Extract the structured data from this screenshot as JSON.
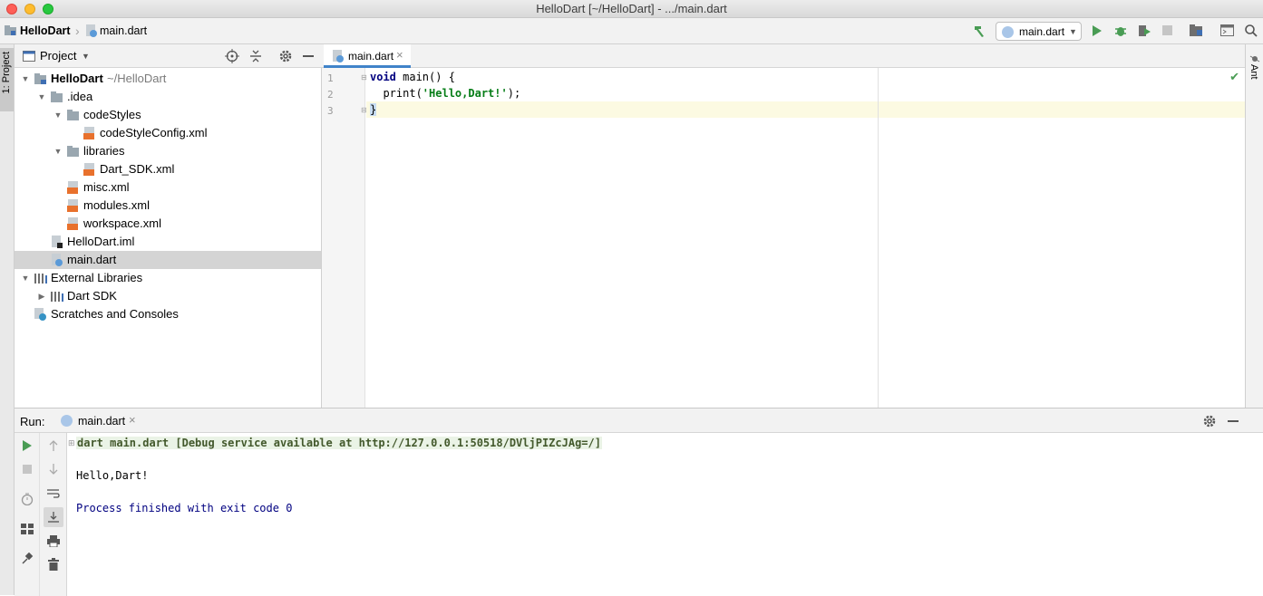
{
  "window": {
    "title": "HelloDart [~/HelloDart] - .../main.dart"
  },
  "breadcrumb": {
    "project": "HelloDart",
    "file": "main.dart"
  },
  "toolbar": {
    "run_config": "main.dart"
  },
  "side_tabs": {
    "left": "1: Project",
    "right": "Ant"
  },
  "project_panel": {
    "title": "Project",
    "tree": [
      {
        "label": "HelloDart",
        "suffix": "~/HelloDart",
        "level": 0,
        "expanded": true,
        "icon": "module-folder-icon"
      },
      {
        "label": ".idea",
        "level": 1,
        "expanded": true,
        "icon": "folder-icon"
      },
      {
        "label": "codeStyles",
        "level": 2,
        "expanded": true,
        "icon": "folder-icon"
      },
      {
        "label": "codeStyleConfig.xml",
        "level": 3,
        "icon": "xml-file-icon"
      },
      {
        "label": "libraries",
        "level": 2,
        "expanded": true,
        "icon": "folder-icon"
      },
      {
        "label": "Dart_SDK.xml",
        "level": 3,
        "icon": "xml-file-icon"
      },
      {
        "label": "misc.xml",
        "level": 2,
        "icon": "xml-file-icon"
      },
      {
        "label": "modules.xml",
        "level": 2,
        "icon": "xml-file-icon"
      },
      {
        "label": "workspace.xml",
        "level": 2,
        "icon": "xml-file-icon"
      },
      {
        "label": "HelloDart.iml",
        "level": 1,
        "icon": "iml-file-icon"
      },
      {
        "label": "main.dart",
        "level": 1,
        "icon": "dart-file-icon",
        "selected": true
      },
      {
        "label": "External Libraries",
        "level": 0,
        "expanded": true,
        "icon": "libraries-icon"
      },
      {
        "label": "Dart SDK",
        "level": 1,
        "expanded": false,
        "icon": "library-icon"
      },
      {
        "label": "Scratches and Consoles",
        "level": 0,
        "icon": "scratches-icon"
      }
    ]
  },
  "editor": {
    "tab_label": "main.dart",
    "lines": [
      {
        "num": "1",
        "kw": "void",
        "rest": " main() {"
      },
      {
        "num": "2",
        "pre": "  print(",
        "str": "'Hello,Dart!'",
        "post": ");"
      },
      {
        "num": "3",
        "text": "}"
      }
    ]
  },
  "run_panel": {
    "label": "Run:",
    "tab_label": "main.dart",
    "console": [
      "dart main.dart [Debug service available at http://127.0.0.1:50518/DVljPIZcJAg=/]",
      "Hello,Dart!",
      "Process finished with exit code 0"
    ]
  },
  "colors": {
    "accent": "#4083c9",
    "run_green": "#499c54",
    "xml_orange": "#e8712d",
    "keyword": "#000080",
    "string": "#067d17",
    "console_blue": "#000080",
    "caret_line": "#fcfae2"
  }
}
